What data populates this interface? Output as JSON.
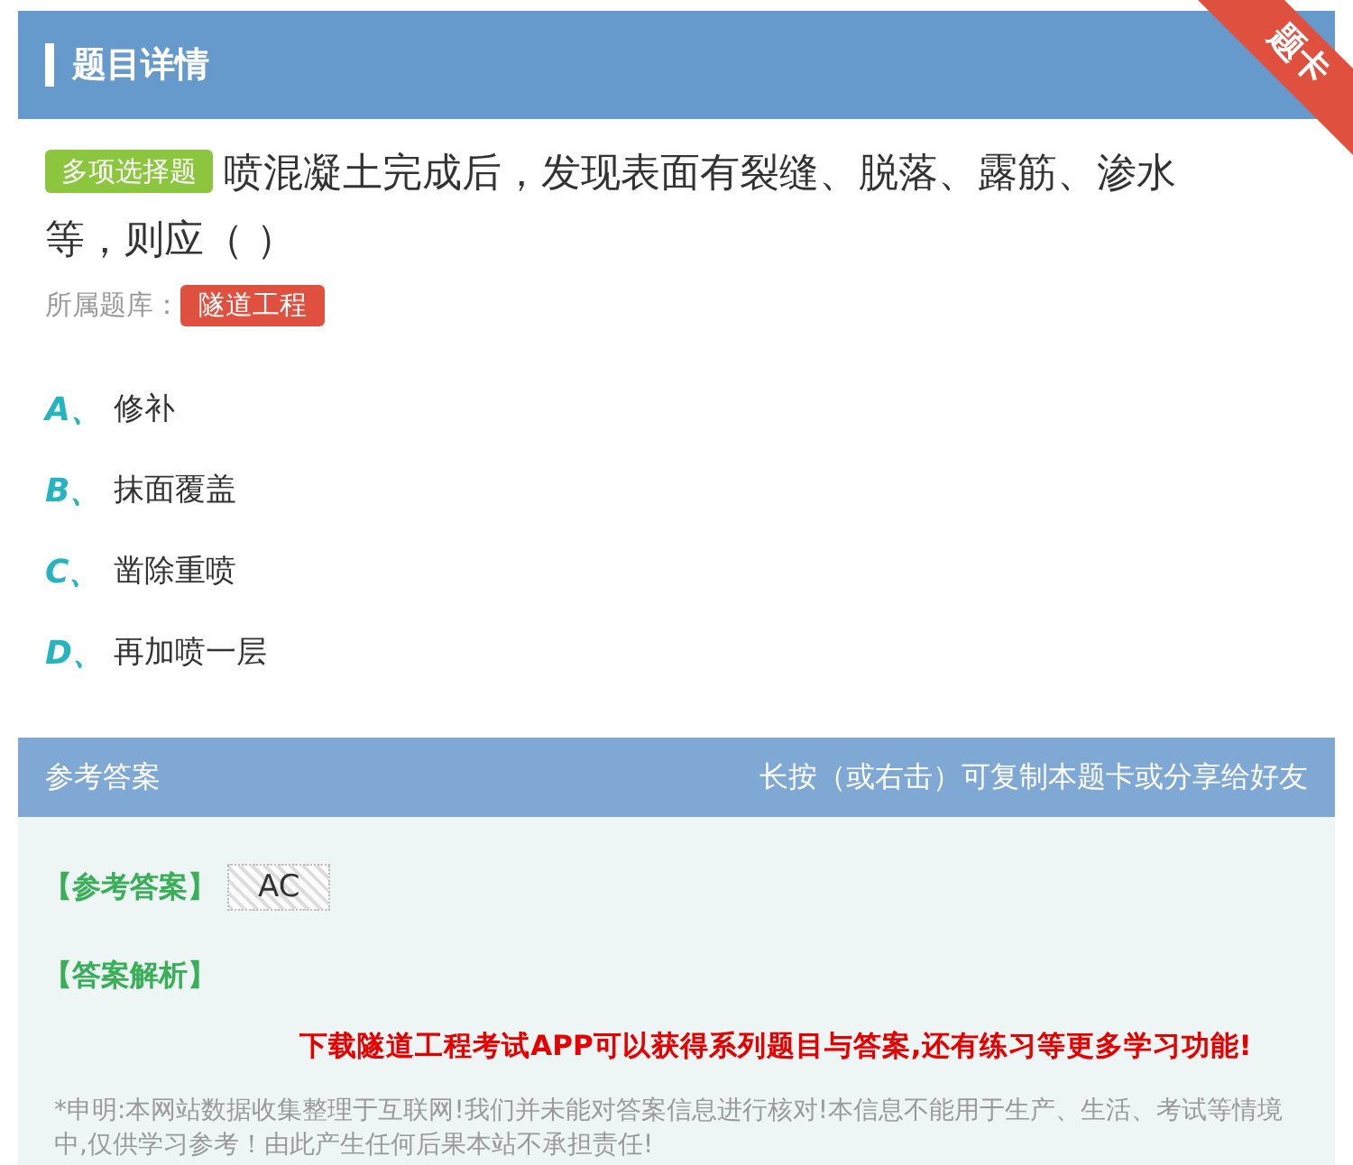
{
  "header": {
    "title": "题目详情",
    "ribbon": "题卡"
  },
  "question": {
    "type_badge": "多项选择题",
    "text": "喷混凝土完成后，发现表面有裂缝、脱落、露筋、渗水等，则应（ ）",
    "source_label": "所属题库：",
    "source_tag": "隧道工程"
  },
  "options": [
    {
      "letter": "A、",
      "text": "修补"
    },
    {
      "letter": "B、",
      "text": "抹面覆盖"
    },
    {
      "letter": "C、",
      "text": "凿除重喷"
    },
    {
      "letter": "D、",
      "text": "再加喷一层"
    }
  ],
  "answer_panel": {
    "title": "参考答案",
    "hint": "长按（或右击）可复制本题卡或分享给好友",
    "answer_label": "【参考答案】",
    "answer": "AC",
    "analysis_label": "【答案解析】",
    "promo": "下载隧道工程考试APP可以获得系列题目与答案,还有练习等更多学习功能!",
    "disclaimer": "*申明:本网站数据收集整理于互联网!我们并未能对答案信息进行核对!本信息不能用于生产、生活、考试等情境中,仅供学习参考！由此产生任何后果本站不承担责任!"
  }
}
